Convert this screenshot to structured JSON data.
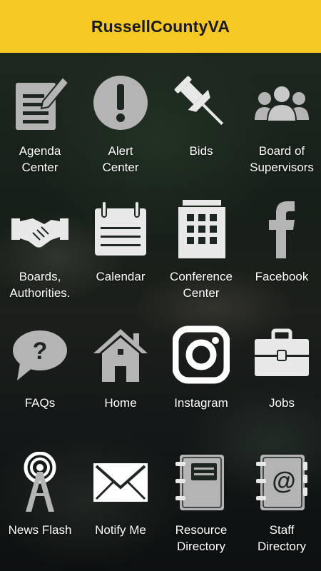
{
  "header": {
    "title": "RussellCountyVA"
  },
  "tiles": [
    {
      "label": "Agenda\nCenter",
      "icon": "agenda-icon"
    },
    {
      "label": "Alert\nCenter",
      "icon": "alert-icon"
    },
    {
      "label": "Bids",
      "icon": "pushpin-icon"
    },
    {
      "label": "Board of\nSupervisors",
      "icon": "people-icon"
    },
    {
      "label": "Boards,\nAuthorities.",
      "icon": "handshake-icon"
    },
    {
      "label": "Calendar",
      "icon": "calendar-icon"
    },
    {
      "label": "Conference\nCenter",
      "icon": "building-icon"
    },
    {
      "label": "Facebook",
      "icon": "facebook-icon"
    },
    {
      "label": "FAQs",
      "icon": "faq-bubble-icon"
    },
    {
      "label": "Home",
      "icon": "house-icon"
    },
    {
      "label": "Instagram",
      "icon": "instagram-icon"
    },
    {
      "label": "Jobs",
      "icon": "briefcase-icon"
    },
    {
      "label": "News Flash",
      "icon": "broadcast-tower-icon"
    },
    {
      "label": "Notify Me",
      "icon": "envelope-icon"
    },
    {
      "label": "Resource\nDirectory",
      "icon": "notebook-icon"
    },
    {
      "label": "Staff\nDirectory",
      "icon": "address-book-icon"
    }
  ],
  "colors": {
    "header_bg": "#f6c823",
    "icon_fill": "#b4b4b4",
    "label": "#ffffff"
  }
}
